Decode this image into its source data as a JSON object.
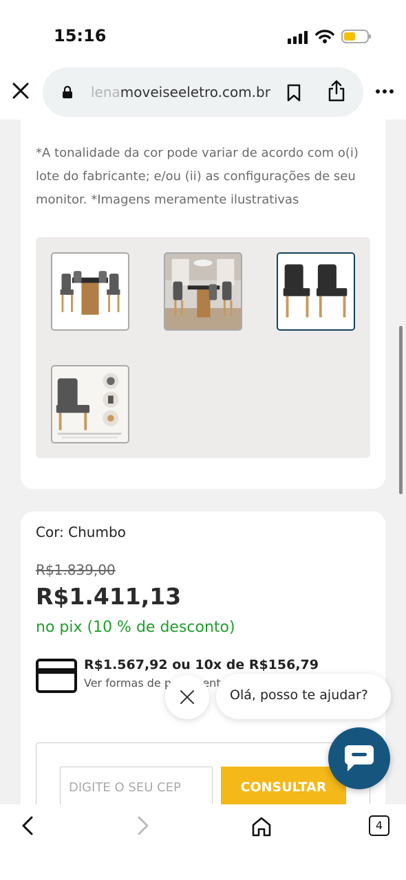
{
  "status_bar": {
    "time": "15:16"
  },
  "browser": {
    "url_faded": "lena",
    "url_main": "moveiseeletro.com.br",
    "tab_count": "4"
  },
  "product": {
    "disclaimer": "*A tonalidade da cor pode variar de acordo com o(i) lote do fabricante; e/ou (ii) as configurações de seu monitor. *Imagens meramente ilustrativas",
    "thumbnails": [
      {
        "name": "table-with-four-chairs",
        "selected": false
      },
      {
        "name": "table-in-room",
        "selected": false
      },
      {
        "name": "two-chairs",
        "selected": true
      },
      {
        "name": "chair-details",
        "selected": false
      }
    ],
    "color_label": "Cor: Chumbo",
    "old_price": "R$1.839,00",
    "price": "R$1.411,13",
    "pix_text": "no pix (10 % de desconto)",
    "installments": "R$1.567,92 ou 10x de R$156,79",
    "payment_forms_link": "Ver formas de pagamento"
  },
  "shipping": {
    "cep_placeholder": "DIGITE O SEU CEP",
    "consult_label": "CONSULTAR"
  },
  "chat": {
    "greeting": "Olá, posso te ajudar?"
  },
  "colors": {
    "price_green": "#1f9e2a",
    "consult_button": "#f5b819",
    "chat_button": "#16567e"
  }
}
